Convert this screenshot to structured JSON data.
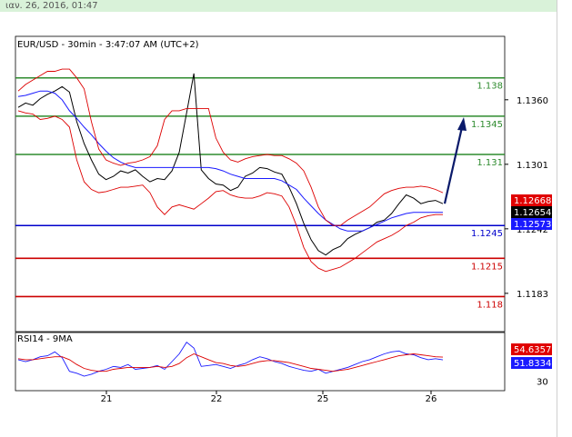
{
  "header": {
    "date_time": "ιαν. 26, 2016, 01:47"
  },
  "chart_data": [
    {
      "type": "line",
      "title": "EUR/USD - 30min - 3:47:07 AM (UTC+2)",
      "x_ticks": [
        "21",
        "22",
        "25",
        "26"
      ],
      "y_ticks": [
        "1.1360",
        "1.1301",
        "1.1242",
        "1.1183"
      ],
      "ylim": [
        1.1148,
        1.1418
      ],
      "levels": [
        {
          "label": "1.138",
          "value": 1.138,
          "color": "#2e8b2e"
        },
        {
          "label": "1.1345",
          "value": 1.1345,
          "color": "#2e8b2e"
        },
        {
          "label": "1.131",
          "value": 1.131,
          "color": "#2e8b2e"
        },
        {
          "label": "1.1245",
          "value": 1.1245,
          "color": "#0000cc"
        },
        {
          "label": "1.1215",
          "value": 1.1215,
          "color": "#cc0000"
        },
        {
          "label": "1.118",
          "value": 1.118,
          "color": "#cc0000"
        }
      ],
      "badges": [
        {
          "label": "1.12668",
          "color": "#e00000"
        },
        {
          "label": "1.12654",
          "color": "#000000"
        },
        {
          "label": "1.12573",
          "color": "#1a1aff"
        }
      ],
      "series": [
        {
          "values": [
            1.1353,
            1.1357,
            1.1355,
            1.1361,
            1.1365,
            1.1368,
            1.1372,
            1.1367,
            1.134,
            1.132,
            1.1305,
            1.1292,
            1.1287,
            1.129,
            1.1295,
            1.1293,
            1.1296,
            1.129,
            1.1285,
            1.1288,
            1.1287,
            1.1295,
            1.1312,
            1.1348,
            1.1384,
            1.1296,
            1.1288,
            1.1283,
            1.1282,
            1.1277,
            1.128,
            1.129,
            1.1293,
            1.1298,
            1.1297,
            1.1294,
            1.1292,
            1.128,
            1.1265,
            1.1247,
            1.1232,
            1.1222,
            1.1218,
            1.1223,
            1.1226,
            1.1233,
            1.1237,
            1.124,
            1.1243,
            1.1248,
            1.125,
            1.1256,
            1.1265,
            1.1273,
            1.127,
            1.1265,
            1.1267,
            1.1268,
            1.1265
          ]
        },
        {
          "values": [
            1.1363,
            1.1364,
            1.1366,
            1.1368,
            1.1368,
            1.1366,
            1.136,
            1.135,
            1.1343,
            1.1335,
            1.1328,
            1.132,
            1.1313,
            1.1307,
            1.1303,
            1.13,
            1.1298,
            1.1298,
            1.1298,
            1.1298,
            1.1298,
            1.1298,
            1.1298,
            1.1298,
            1.1298,
            1.1298,
            1.1298,
            1.1297,
            1.1295,
            1.1292,
            1.129,
            1.1288,
            1.1288,
            1.1288,
            1.1288,
            1.1288,
            1.1286,
            1.1282,
            1.1278,
            1.127,
            1.1263,
            1.1256,
            1.125,
            1.1246,
            1.1242,
            1.124,
            1.124,
            1.124,
            1.1243,
            1.1246,
            1.1249,
            1.1252,
            1.1254,
            1.1256,
            1.1257,
            1.1257,
            1.1257,
            1.1257,
            1.1257
          ]
        },
        {
          "values": [
            1.1368,
            1.1374,
            1.1378,
            1.1382,
            1.1386,
            1.1386,
            1.1388,
            1.1388,
            1.138,
            1.137,
            1.134,
            1.1315,
            1.1305,
            1.1302,
            1.13,
            1.1302,
            1.1303,
            1.1305,
            1.1308,
            1.1318,
            1.1342,
            1.135,
            1.135,
            1.1352,
            1.1352,
            1.1352,
            1.1352,
            1.1325,
            1.1312,
            1.1305,
            1.1303,
            1.1306,
            1.1308,
            1.1309,
            1.131,
            1.1309,
            1.1309,
            1.1306,
            1.1302,
            1.1295,
            1.128,
            1.1262,
            1.125,
            1.1245,
            1.1245,
            1.125,
            1.1254,
            1.1258,
            1.1262,
            1.1268,
            1.1274,
            1.1277,
            1.1279,
            1.128,
            1.128,
            1.1281,
            1.128,
            1.1278,
            1.1275
          ]
        },
        {
          "values": [
            1.135,
            1.1348,
            1.1347,
            1.1342,
            1.1343,
            1.1345,
            1.1342,
            1.1335,
            1.1305,
            1.1285,
            1.1278,
            1.1275,
            1.1276,
            1.1278,
            1.128,
            1.128,
            1.1281,
            1.1282,
            1.1275,
            1.1262,
            1.1255,
            1.1262,
            1.1264,
            1.1262,
            1.126,
            1.1265,
            1.127,
            1.1276,
            1.1277,
            1.1273,
            1.1271,
            1.127,
            1.127,
            1.1272,
            1.1275,
            1.1274,
            1.1272,
            1.1262,
            1.1245,
            1.1225,
            1.1212,
            1.1206,
            1.1203,
            1.1205,
            1.1207,
            1.1211,
            1.1215,
            1.122,
            1.1225,
            1.123,
            1.1233,
            1.1236,
            1.124,
            1.1245,
            1.1248,
            1.1252,
            1.1254,
            1.1255,
            1.1255
          ]
        }
      ]
    },
    {
      "type": "line",
      "title": "RSI14 - 9MA",
      "y_ticks": [
        "30"
      ],
      "ylim": [
        20,
        80
      ],
      "badges": [
        {
          "label": "54.6357",
          "color": "#e00000"
        },
        {
          "label": "51.8334",
          "color": "#1a1aff"
        }
      ],
      "series": [
        {
          "values": [
            52,
            50,
            52,
            55,
            56,
            60,
            54,
            40,
            38,
            35,
            37,
            40,
            42,
            45,
            44,
            47,
            42,
            43,
            44,
            46,
            42,
            50,
            58,
            70,
            64,
            45,
            46,
            47,
            45,
            43,
            46,
            48,
            52,
            55,
            53,
            50,
            48,
            45,
            43,
            41,
            40,
            42,
            38,
            40,
            42,
            44,
            47,
            50,
            52,
            55,
            58,
            60,
            61,
            58,
            57,
            54,
            52,
            53,
            51.8
          ]
        },
        {
          "values": [
            53,
            52,
            52,
            53,
            54,
            55,
            55,
            52,
            47,
            43,
            41,
            40,
            40,
            42,
            43,
            44,
            44,
            44,
            44,
            45,
            44,
            45,
            48,
            54,
            58,
            55,
            52,
            49,
            48,
            46,
            45,
            46,
            48,
            50,
            51,
            51,
            50,
            49,
            47,
            45,
            43,
            42,
            41,
            40,
            41,
            42,
            44,
            46,
            48,
            50,
            52,
            54,
            56,
            57,
            58,
            57,
            56,
            55,
            54.6
          ]
        }
      ]
    }
  ]
}
